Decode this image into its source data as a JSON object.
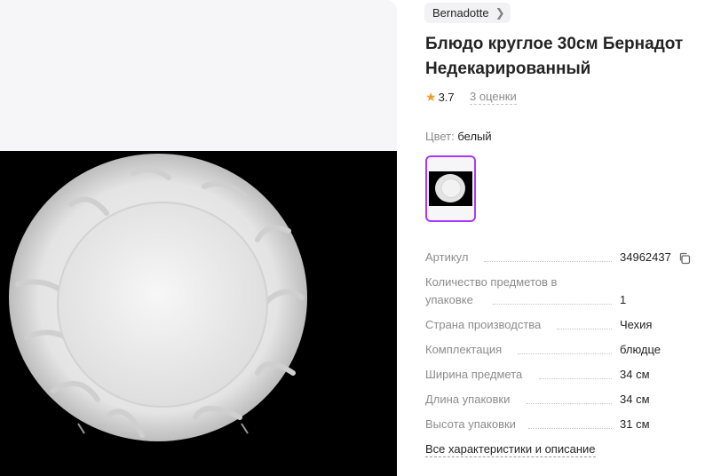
{
  "brand": {
    "label": "Bernadotte",
    "chevron_icon": "chevron-right-icon"
  },
  "product": {
    "title_line1": "Блюдо круглое 30см Бернадот",
    "title_line2": "Недекарированный"
  },
  "rating": {
    "value": "3.7",
    "reviews_label": "3 оценки",
    "star_color": "#f29a2e"
  },
  "color": {
    "label": "Цвет:",
    "value": "белый",
    "selected_border": "#a73afd"
  },
  "specs": [
    {
      "name": "Артикул",
      "value": "34962437"
    },
    {
      "name_line1": "Количество предметов в",
      "name_line2": "упаковке",
      "value": "1"
    },
    {
      "name": "Страна производства",
      "value": "Чехия"
    },
    {
      "name": "Комплектация",
      "value": "блюдце"
    },
    {
      "name": "Ширина предмета",
      "value": "34 см"
    },
    {
      "name": "Длина упаковки",
      "value": "34 см"
    },
    {
      "name": "Высота упаковки",
      "value": "31 см"
    }
  ],
  "all_specs_link": "Все характеристики и описание"
}
